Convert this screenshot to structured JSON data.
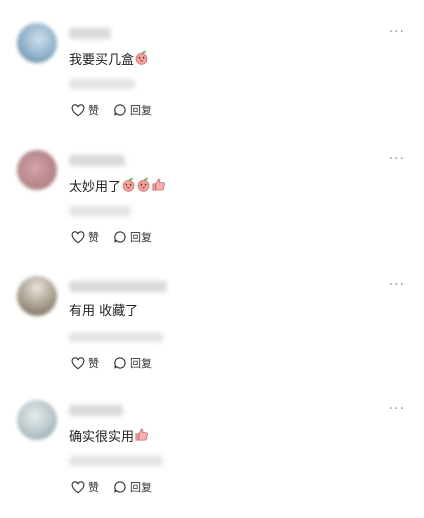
{
  "comments": [
    {
      "text": "我要买几盒",
      "emojis": [
        "peach-emoji"
      ],
      "like_label": "赞",
      "reply_label": "回复",
      "more_label": "···",
      "avatar_colors": [
        "#cfe0ef",
        "#8fb0c8",
        "#5a7a8f"
      ]
    },
    {
      "text": "太妙用了",
      "emojis": [
        "peach-emoji",
        "peach-emoji",
        "thumbs-up-emoji"
      ],
      "like_label": "赞",
      "reply_label": "回复",
      "more_label": "···",
      "avatar_colors": [
        "#d6a4a8",
        "#b98a8f",
        "#a07a6a"
      ]
    },
    {
      "text": "有用 收藏了",
      "emojis": [],
      "like_label": "赞",
      "reply_label": "回复",
      "more_label": "···",
      "avatar_colors": [
        "#e8e3da",
        "#a59b8a",
        "#6d6456"
      ]
    },
    {
      "text": "确实很实用",
      "emojis": [
        "thumbs-up-emoji"
      ],
      "like_label": "赞",
      "reply_label": "回复",
      "more_label": "···",
      "avatar_colors": [
        "#e6ecef",
        "#b6c5c9",
        "#7e9aa0"
      ]
    }
  ],
  "colors": {
    "text": "#222222",
    "muted": "#9a9a9a",
    "emoji": "#e8727a"
  }
}
